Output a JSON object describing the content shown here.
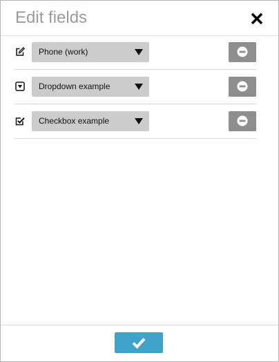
{
  "dialog": {
    "title": "Edit fields",
    "close_icon": "close-icon",
    "confirm_icon": "check-icon",
    "accent_color": "#3ea3c8"
  },
  "fields": [
    {
      "type_icon": "edit-icon",
      "selected": "Phone (work)",
      "remove_icon": "minus-circle-icon"
    },
    {
      "type_icon": "dropdown-icon",
      "selected": "Dropdown example",
      "remove_icon": "minus-circle-icon"
    },
    {
      "type_icon": "checkbox-icon",
      "selected": "Checkbox example",
      "remove_icon": "minus-circle-icon"
    }
  ]
}
